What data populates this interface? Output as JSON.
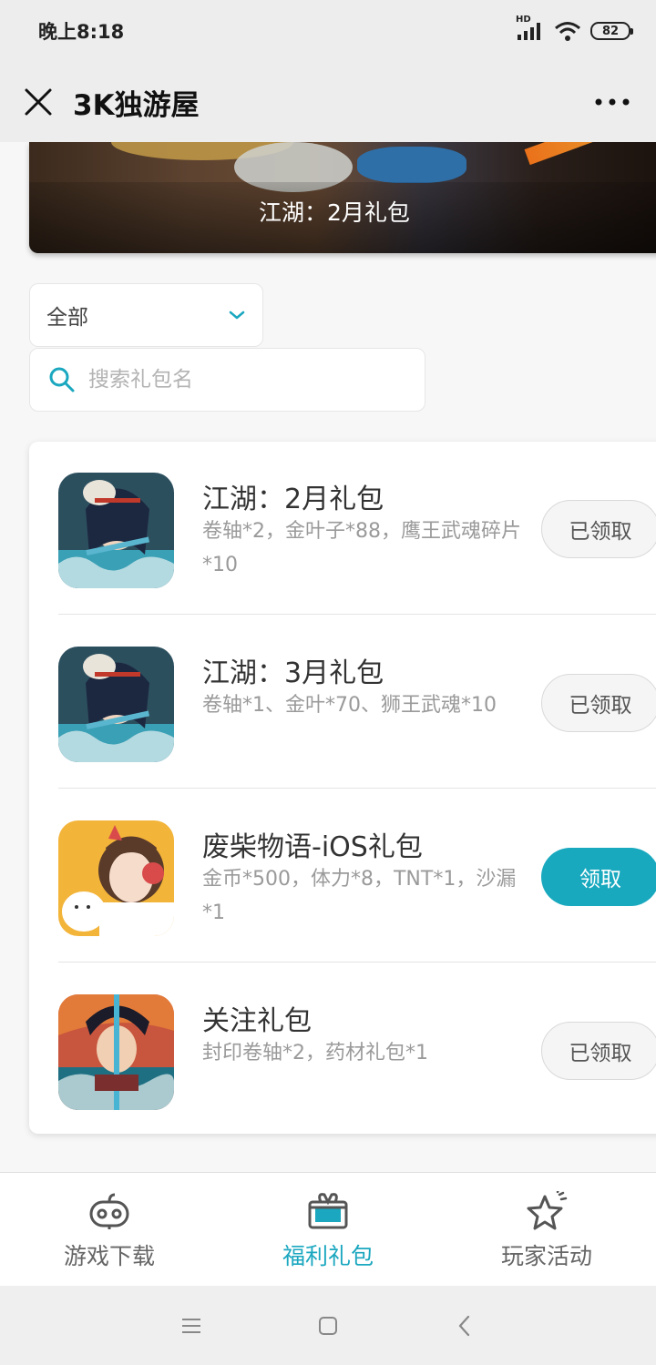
{
  "status_bar": {
    "time": "晚上8:18",
    "network": "HD",
    "battery": "82"
  },
  "title_bar": {
    "title": "3K独游屋"
  },
  "banner": {
    "caption": "江湖：2月礼包"
  },
  "filter": {
    "selected": "全部"
  },
  "search": {
    "placeholder": "搜索礼包名"
  },
  "gifts": [
    {
      "name": "江湖：2月礼包",
      "desc": "卷轴*2，金叶子*88，鹰王武魂碎片*10",
      "button": "已领取",
      "claimed": true,
      "icon": "jianghu-game-icon"
    },
    {
      "name": "江湖：3月礼包",
      "desc": "卷轴*1、金叶*70、狮王武魂*10",
      "button": "已领取",
      "claimed": true,
      "icon": "jianghu-game-icon"
    },
    {
      "name": "废柴物语-iOS礼包",
      "desc": "金币*500，体力*8，TNT*1，沙漏*1",
      "button": "领取",
      "claimed": false,
      "icon": "feichai-game-icon"
    },
    {
      "name": "关注礼包",
      "desc": "封印卷轴*2，药材礼包*1",
      "button": "已领取",
      "claimed": true,
      "icon": "swordsman-game-icon"
    }
  ],
  "tabs": [
    {
      "label": "游戏下载",
      "icon": "gamepad-icon",
      "active": false
    },
    {
      "label": "福利礼包",
      "icon": "gift-icon",
      "active": true
    },
    {
      "label": "玩家活动",
      "icon": "star-icon",
      "active": false
    }
  ],
  "colors": {
    "accent": "#19a9bf",
    "header_bg": "#ededed"
  }
}
